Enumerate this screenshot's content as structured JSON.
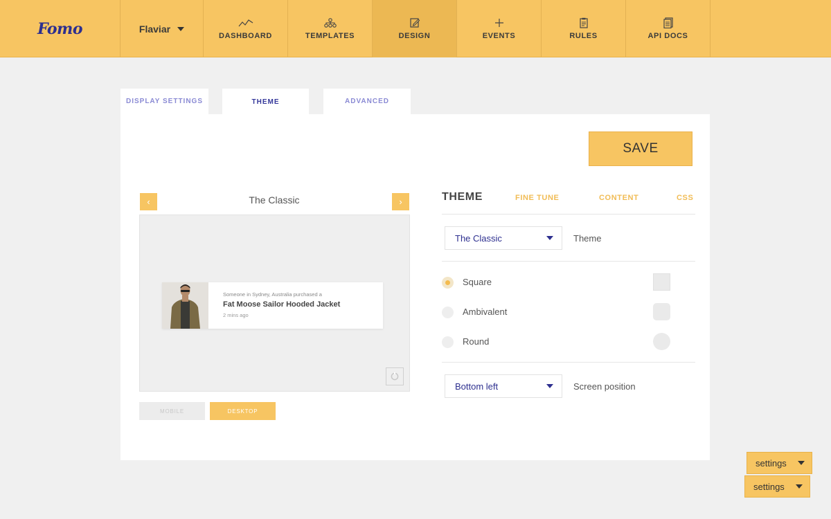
{
  "app": {
    "logo": "Fomo"
  },
  "account": {
    "name": "Flaviar"
  },
  "nav": [
    {
      "label": "DASHBOARD",
      "icon": "chart-line-icon"
    },
    {
      "label": "TEMPLATES",
      "icon": "sitemap-icon"
    },
    {
      "label": "DESIGN",
      "icon": "edit-icon",
      "active": true
    },
    {
      "label": "EVENTS",
      "icon": "plus-icon"
    },
    {
      "label": "RULES",
      "icon": "clipboard-icon"
    },
    {
      "label": "API DOCS",
      "icon": "document-icon"
    }
  ],
  "section_tabs": [
    {
      "label": "DISPLAY SETTINGS"
    },
    {
      "label": "THEME",
      "active": true
    },
    {
      "label": "ADVANCED"
    }
  ],
  "save_label": "SAVE",
  "preview": {
    "title": "The Classic",
    "prev_icon": "chevron-left-icon",
    "next_icon": "chevron-right-icon",
    "notification": {
      "small_text": "Someone in Sydney, Australia purchased a",
      "title": "Fat Moose Sailor Hooded Jacket",
      "time": "2 mins ago"
    },
    "mobile_label": "MOBILE",
    "desktop_label": "DESKTOP"
  },
  "settings_tabs": [
    {
      "label": "THEME",
      "active": true
    },
    {
      "label": "FINE TUNE"
    },
    {
      "label": "CONTENT"
    },
    {
      "label": "CSS"
    }
  ],
  "theme_select": {
    "value": "The Classic",
    "label": "Theme"
  },
  "shape_options": [
    {
      "label": "Square",
      "selected": true
    },
    {
      "label": "Ambivalent",
      "selected": false
    },
    {
      "label": "Round",
      "selected": false
    }
  ],
  "position_select": {
    "value": "Bottom left",
    "label": "Screen position"
  },
  "floating": [
    {
      "label": "settings"
    },
    {
      "label": "settings"
    }
  ],
  "colors": {
    "brand": "#f7c562",
    "accent": "#2d2f8f",
    "tab_inactive": "#8a8ad4"
  }
}
